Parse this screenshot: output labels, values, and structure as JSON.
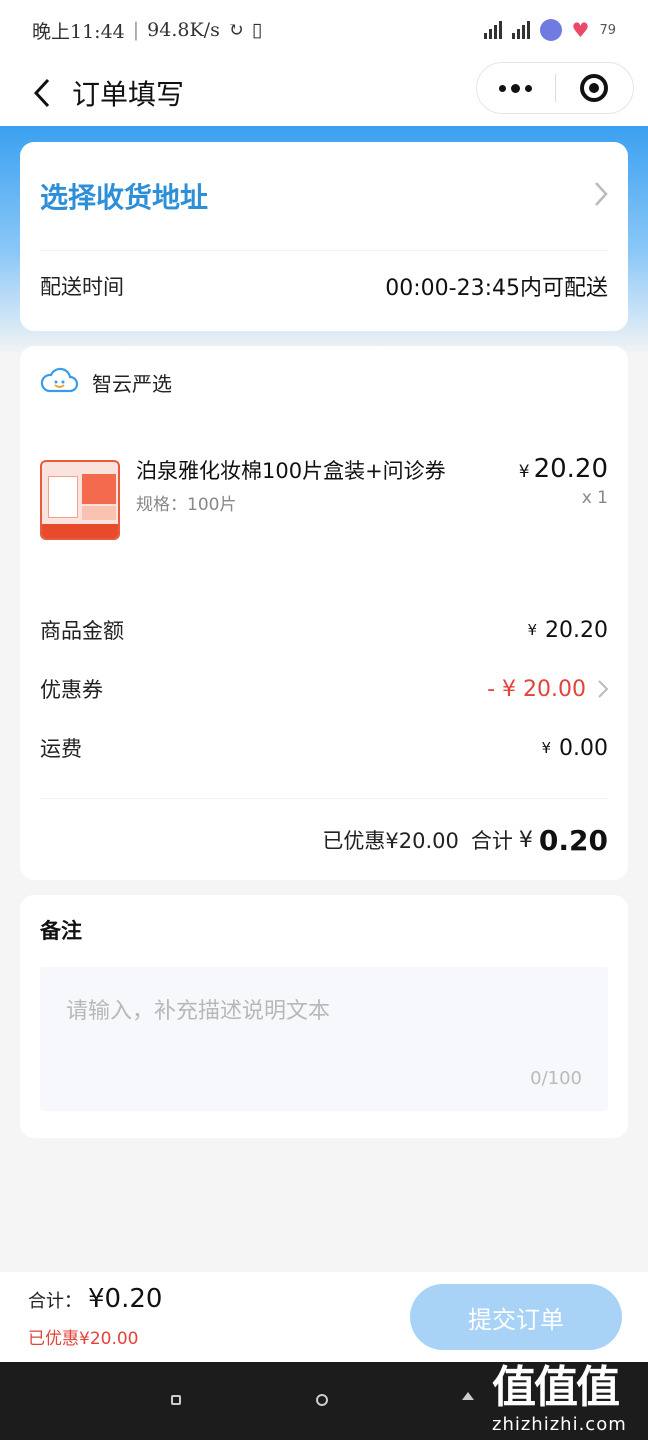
{
  "status_bar": {
    "time": "晚上11:44",
    "speed": "94.8K/s",
    "battery": "79"
  },
  "nav": {
    "title": "订单填写"
  },
  "address": {
    "select_label": "选择收货地址",
    "delivery_label": "配送时间",
    "delivery_value": "00:00-23:45内可配送"
  },
  "shop": {
    "name": "智云严选"
  },
  "product": {
    "name": "泊泉雅化妆棉100片盒装+问诊券",
    "spec": "规格：100片",
    "price": "20.20",
    "qty": "x 1"
  },
  "summary": {
    "goods_label": "商品金额",
    "goods_value": "20.20",
    "coupon_label": "优惠券",
    "coupon_value": "- ¥ 20.00",
    "shipping_label": "运费",
    "shipping_value": "0.00",
    "discount_text": "已优惠¥20.00",
    "total_label": "合计",
    "total_value": "0.20"
  },
  "note": {
    "title": "备注",
    "placeholder": "请输入，补充描述说明文本",
    "count": "0/100"
  },
  "bottom": {
    "total_label": "合计：",
    "total_value": "¥0.20",
    "discount": "已优惠¥20.00",
    "submit": "提交订单"
  },
  "watermark": {
    "big": "值值值",
    "small": "zhizhizhi.com"
  },
  "colors": {
    "accent": "#2d8fd8",
    "price_red": "#e2433a",
    "button_disabled": "#a8d2f6"
  }
}
